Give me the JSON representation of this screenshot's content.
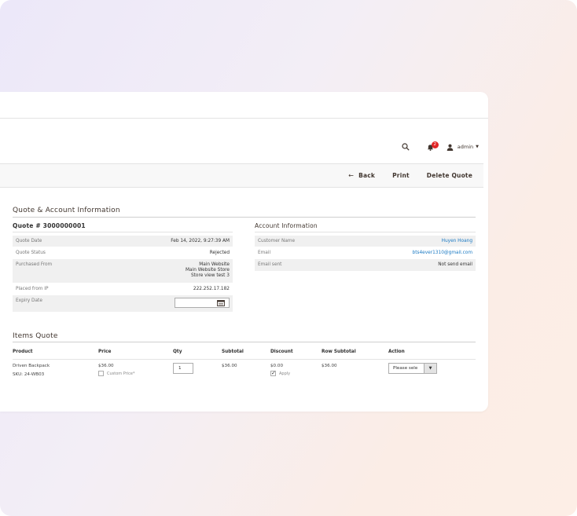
{
  "header": {
    "notification_count": "2",
    "user_label": "admin"
  },
  "toolbar": {
    "back_label": "Back",
    "print_label": "Print",
    "delete_label": "Delete Quote"
  },
  "quote_section": {
    "title": "Quote & Account Information",
    "quote_number": "Quote # 3000000001",
    "rows": {
      "date_label": "Quote Date",
      "date_value": "Feb 14, 2022, 9:27:39 AM",
      "status_label": "Quote Status",
      "status_value": "Rejected",
      "purchased_label": "Purchased From",
      "purchased_line1": "Main Website",
      "purchased_line2": "Main Website Store",
      "purchased_line3": "Store view test 3",
      "ip_label": "Placed from IP",
      "ip_value": "222.252.17.182",
      "expiry_label": "Expiry Date"
    }
  },
  "account_section": {
    "title": "Account Information",
    "customer_label": "Customer Name",
    "customer_value": "Huyen Hoang",
    "email_label": "Email",
    "email_value": "bts4ever1310@gmail.com",
    "email_sent_label": "Email sent",
    "email_sent_value": "Not send email"
  },
  "items": {
    "title": "Items Quote",
    "columns": {
      "product": "Product",
      "price": "Price",
      "qty": "Qty",
      "subtotal": "Subtotal",
      "discount": "Discount",
      "row_subtotal": "Row Subtotal",
      "action": "Action"
    },
    "row": {
      "product_name": "Driven Backpack",
      "sku": "SKU: 24-WB03",
      "price": "$36.00",
      "custom_price_label": "Custom Price*",
      "qty": "1",
      "subtotal": "$36.00",
      "discount": "$0.00",
      "apply_label": "Apply",
      "row_subtotal": "$36.00",
      "action_value": "Please sele"
    }
  },
  "colors": {
    "link": "#1979c3",
    "badge": "#e22626"
  }
}
